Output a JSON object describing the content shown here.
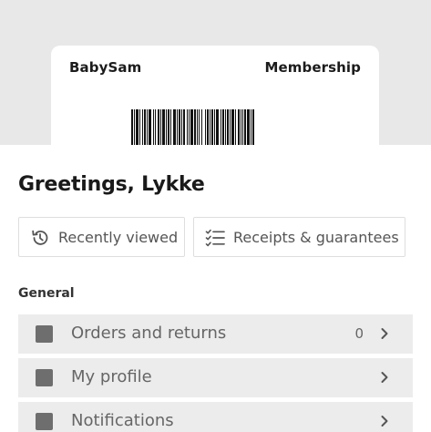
{
  "card": {
    "brand": "BabySam",
    "type": "Membership"
  },
  "greeting": "Greetings, Lykke",
  "quick_actions": [
    {
      "label": "Recently viewed",
      "icon": "history-icon"
    },
    {
      "label": "Receipts & guarantees",
      "icon": "checklist-icon"
    }
  ],
  "sections": {
    "general": {
      "title": "General",
      "items": [
        {
          "label": "Orders and returns",
          "count": "0",
          "icon": "square-icon"
        },
        {
          "label": "My profile",
          "count": "",
          "icon": "square-icon"
        },
        {
          "label": "Notifications",
          "count": "",
          "icon": "square-icon"
        }
      ]
    }
  },
  "colors": {
    "band": "#e8e8e8",
    "row_bg": "#ececec",
    "icon": "#6e6e6e",
    "text_dark": "#1a1a1a",
    "text_muted": "#666666"
  }
}
